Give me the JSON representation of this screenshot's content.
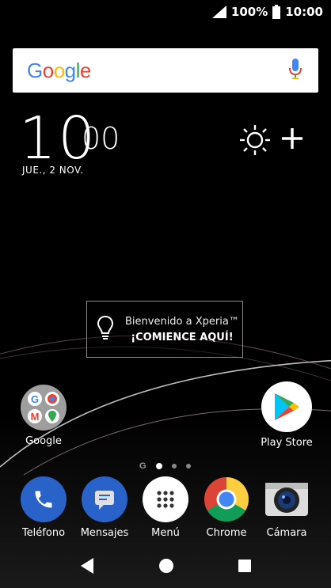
{
  "status": {
    "battery": "100%",
    "time": "10:00"
  },
  "search": {
    "logo_letters": [
      "G",
      "o",
      "o",
      "g",
      "l",
      "e"
    ]
  },
  "clock": {
    "hours": "10",
    "minutes": "00",
    "date": "JUE., 2 NOV."
  },
  "welcome": {
    "line1": "Bienvenido a Xperia™",
    "line2": "¡COMIENCE AQUÍ!"
  },
  "home": {
    "folder_google": {
      "label": "Google"
    },
    "play_store": {
      "label": "Play Store"
    }
  },
  "dock": [
    {
      "label": "Teléfono"
    },
    {
      "label": "Mensajes"
    },
    {
      "label": "Menú"
    },
    {
      "label": "Chrome"
    },
    {
      "label": "Cámara"
    }
  ],
  "page_indicator": {
    "google_letter": "G",
    "pages": 3,
    "active_page": 1
  },
  "colors": {
    "accent_blue": "#2962c9",
    "google_blue": "#4285F4",
    "google_red": "#EA4335",
    "google_yellow": "#FBBC05",
    "google_green": "#34A853"
  }
}
